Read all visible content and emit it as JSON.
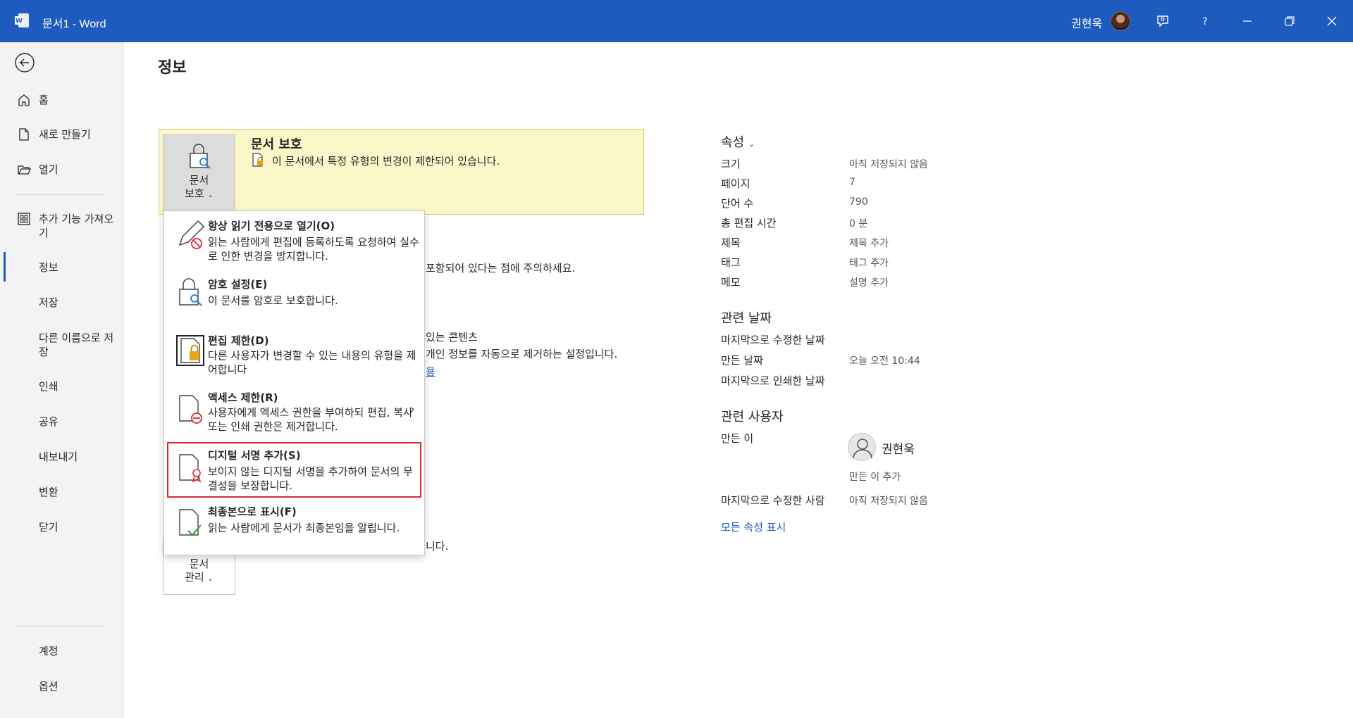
{
  "titlebar": {
    "title": "문서1  -  Word",
    "user": "권현욱"
  },
  "sidebar": {
    "items": [
      {
        "label": "홈",
        "icon": "home-icon"
      },
      {
        "label": "새로 만들기",
        "icon": "new-doc-icon"
      },
      {
        "label": "열기",
        "icon": "folder-open-icon"
      },
      {
        "label": "추가 기능 가져오기",
        "icon": "add-ins-icon"
      },
      {
        "label": "정보",
        "icon": ""
      },
      {
        "label": "저장",
        "icon": ""
      },
      {
        "label": "다른 이름으로 저장",
        "icon": ""
      },
      {
        "label": "인쇄",
        "icon": ""
      },
      {
        "label": "공유",
        "icon": ""
      },
      {
        "label": "내보내기",
        "icon": ""
      },
      {
        "label": "변환",
        "icon": ""
      },
      {
        "label": "닫기",
        "icon": ""
      }
    ],
    "bottom": [
      {
        "label": "계정"
      },
      {
        "label": "옵션"
      }
    ]
  },
  "main": {
    "title": "정보",
    "protect": {
      "button_line1": "문서",
      "button_line2": "보호",
      "heading": "문서 보호",
      "desc": "이 문서에서 특정 유형의 변경이 제한되어 있습니다."
    },
    "hidden_fragments": {
      "inspect_line": "포함되어 있다는 점에 주의하세요.",
      "content_line": "있는 콘텐츠",
      "privacy_line": "개인 정보를 자동으로 제거하는 설정입니다.",
      "link_fragment": "용",
      "manage_line": "니다."
    },
    "manage": {
      "line1": "문서",
      "line2": "관리"
    }
  },
  "dropdown": {
    "items": [
      {
        "title": "항상 읽기 전용으로 열기(O)",
        "desc": "읽는 사람에게 편집에 등록하도록 요청하여 실수로 인한 변경을 방지합니다."
      },
      {
        "title": "암호 설정(E)",
        "desc": "이 문서를 암호로 보호합니다."
      },
      {
        "title": "편집 제한(D)",
        "desc": "다른 사용자가 변경할 수 있는 내용의 유형을 제어합니다"
      },
      {
        "title": "액세스 제한(R)",
        "desc": "사용자에게 액세스 권한을 부여하되 편집, 복사 또는 인쇄 권한은 제거합니다."
      },
      {
        "title": "디지털 서명 추가(S)",
        "desc": "보이지 않는 디지털 서명을 추가하여 문서의 무결성을 보장합니다."
      },
      {
        "title": "최종본으로 표시(F)",
        "desc": "읽는 사람에게 문서가 최종본임을 알립니다."
      }
    ]
  },
  "properties": {
    "heading": "속성",
    "rows": [
      {
        "label": "크기",
        "value": "아직 저장되지 않음"
      },
      {
        "label": "페이지",
        "value": "7"
      },
      {
        "label": "단어 수",
        "value": "790"
      },
      {
        "label": "총 편집 시간",
        "value": "0 분"
      },
      {
        "label": "제목",
        "value": "제목 추가"
      },
      {
        "label": "태그",
        "value": "태그 추가"
      },
      {
        "label": "메모",
        "value": "설명 추가"
      }
    ],
    "dates_heading": "관련 날짜",
    "dates": [
      {
        "label": "마지막으로 수정한 날짜",
        "value": ""
      },
      {
        "label": "만든 날짜",
        "value": "오늘 오전 10:44"
      },
      {
        "label": "마지막으로 인쇄한 날짜",
        "value": ""
      }
    ],
    "people_heading": "관련 사용자",
    "creator_label": "만든 이",
    "creator_name": "권현욱",
    "add_creator": "만든 이 추가",
    "last_modified_by_label": "마지막으로 수정한 사람",
    "last_modified_by_value": "아직 저장되지 않음",
    "show_all": "모든 속성 표시"
  },
  "colors": {
    "accent": "#1e5bbf",
    "protect_bg": "#fcf7c9",
    "highlight_border": "#e0262e"
  }
}
